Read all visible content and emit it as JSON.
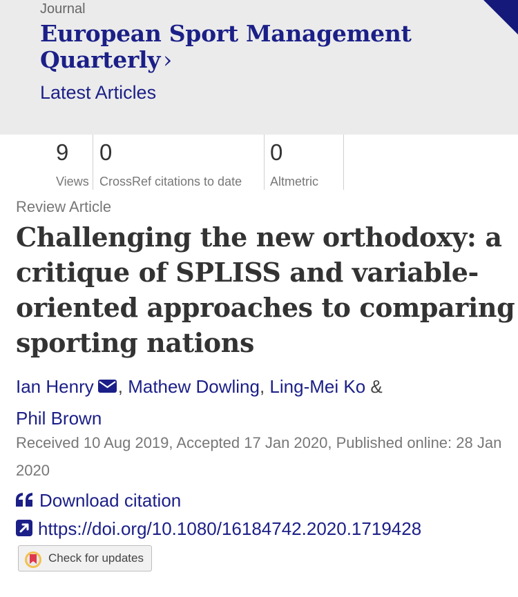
{
  "journal": {
    "kicker": "Journal",
    "title": "European Sport Management Quarterly",
    "chevron": "›",
    "latest": "Latest Articles"
  },
  "metrics": [
    {
      "value": "9",
      "label": "Views"
    },
    {
      "value": "0",
      "label": "CrossRef citations to date"
    },
    {
      "value": "0",
      "label": "Altmetric"
    }
  ],
  "article": {
    "type": "Review Article",
    "title": "Challenging the new orthodoxy: a critique of SPLISS and variable-oriented approaches to comparing sporting nations"
  },
  "authors": [
    {
      "name": "Ian Henry",
      "has_email_icon": true
    },
    {
      "name": "Mathew Dowling"
    },
    {
      "name": "Ling-Mei Ko"
    },
    {
      "name": "Phil Brown"
    }
  ],
  "separators": {
    "comma": ",",
    "ampersand": "&"
  },
  "dates": "Received 10 Aug 2019, Accepted 17 Jan 2020, Published online: 28 Jan 2020",
  "actions": {
    "download_citation": "Download citation",
    "doi": "https://doi.org/10.1080/16184742.2020.1719428",
    "check_updates": "Check for updates"
  },
  "colors": {
    "link": "#1b1f87",
    "header_bg": "#ebebeb",
    "corner": "#14197a"
  },
  "icons": [
    "chevron-right-icon",
    "email-icon",
    "quote-icon",
    "external-link-icon",
    "crossmark-icon"
  ]
}
